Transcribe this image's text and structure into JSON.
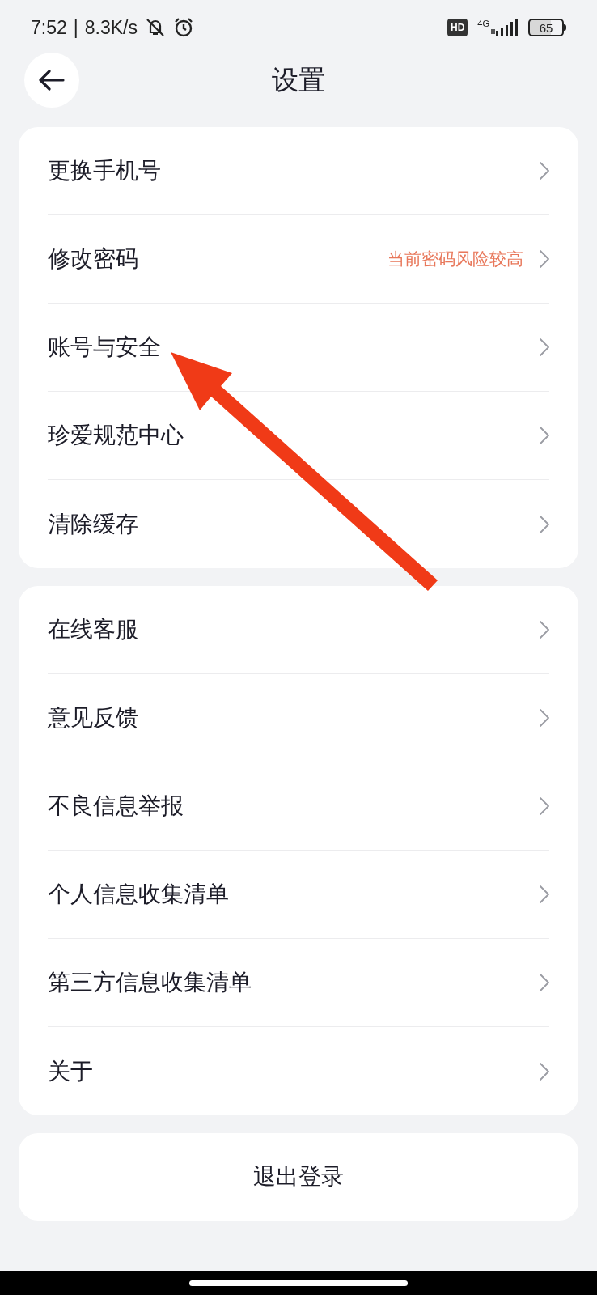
{
  "status_bar": {
    "time": "7:52",
    "separator": "|",
    "speed": "8.3K/s",
    "hd": "HD",
    "network": "4G",
    "battery": "65"
  },
  "header": {
    "title": "设置"
  },
  "groups": [
    {
      "items": [
        {
          "label": "更换手机号"
        },
        {
          "label": "修改密码",
          "note": "当前密码风险较高"
        },
        {
          "label": "账号与安全"
        },
        {
          "label": "珍爱规范中心"
        },
        {
          "label": "清除缓存"
        }
      ]
    },
    {
      "items": [
        {
          "label": "在线客服"
        },
        {
          "label": "意见反馈"
        },
        {
          "label": "不良信息举报"
        },
        {
          "label": "个人信息收集清单"
        },
        {
          "label": "第三方信息收集清单"
        },
        {
          "label": "关于"
        }
      ]
    }
  ],
  "logout": "退出登录"
}
